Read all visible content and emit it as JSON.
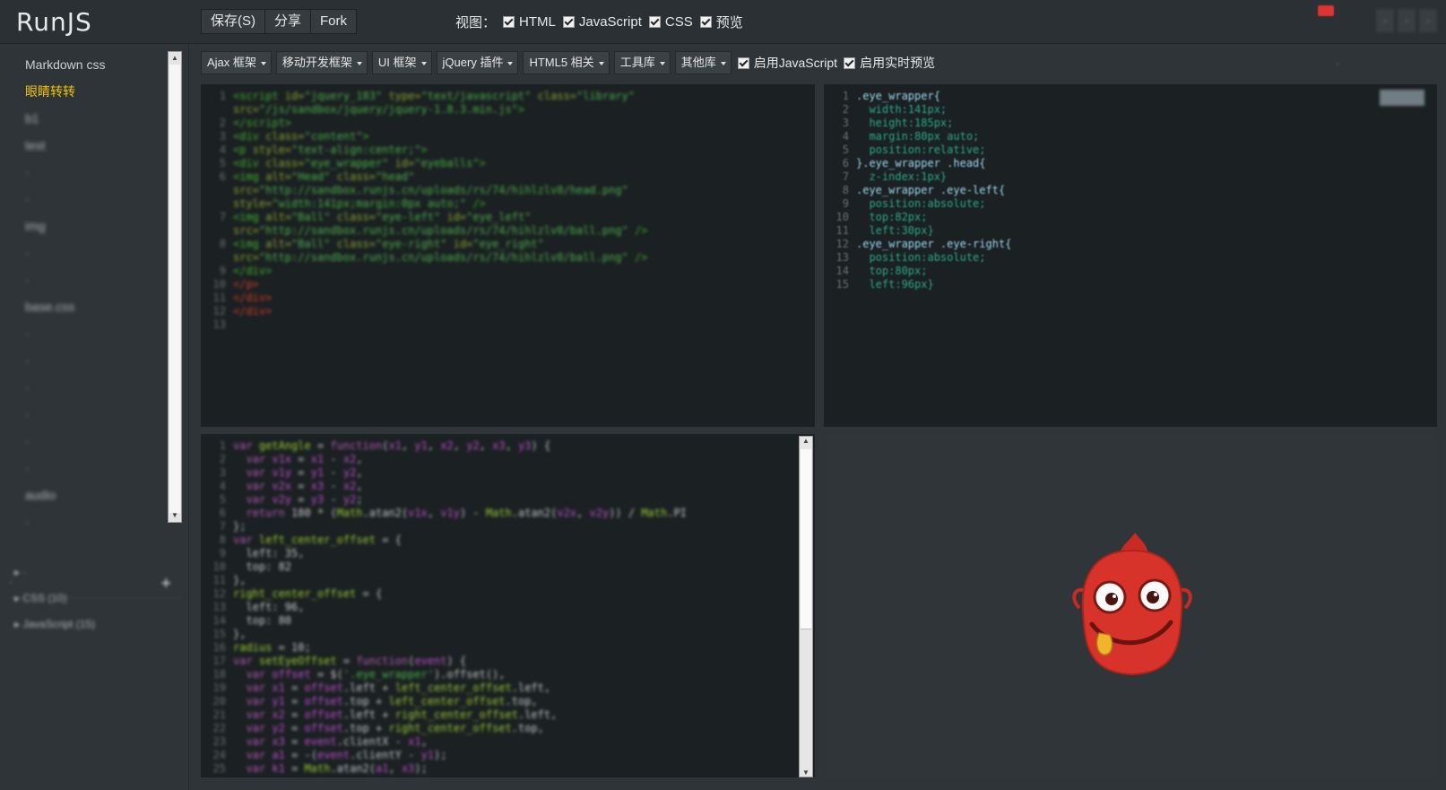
{
  "app": {
    "logo": "RunJS"
  },
  "header": {
    "buttons": [
      {
        "label": "保存(S)"
      },
      {
        "label": "分享"
      },
      {
        "label": "Fork"
      }
    ],
    "view_label": "视图：",
    "view_options": [
      {
        "label": "HTML",
        "checked": true
      },
      {
        "label": "JavaScript",
        "checked": true
      },
      {
        "label": "CSS",
        "checked": true
      },
      {
        "label": "预览",
        "checked": true
      }
    ],
    "right_buttons": [
      {
        "label": "·"
      },
      {
        "label": "·"
      },
      {
        "label": "·"
      }
    ]
  },
  "sidebar": {
    "files": [
      {
        "label": "Markdown css",
        "active": false,
        "readable": true
      },
      {
        "label": "眼睛转转",
        "active": true,
        "readable": true
      },
      {
        "label": "b1",
        "active": false,
        "readable": false
      },
      {
        "label": "test",
        "active": false,
        "readable": false
      },
      {
        "label": "·",
        "active": false,
        "readable": false
      },
      {
        "label": "·",
        "active": false,
        "readable": false
      },
      {
        "label": "img",
        "active": false,
        "readable": false
      },
      {
        "label": "·",
        "active": false,
        "readable": false
      },
      {
        "label": "·",
        "active": false,
        "readable": false
      },
      {
        "label": "base.css",
        "active": false,
        "readable": false
      },
      {
        "label": "·",
        "active": false,
        "readable": false
      },
      {
        "label": "·",
        "active": false,
        "readable": false
      },
      {
        "label": "·",
        "active": false,
        "readable": false
      },
      {
        "label": "·",
        "active": false,
        "readable": false
      },
      {
        "label": "·",
        "active": false,
        "readable": false
      },
      {
        "label": "·",
        "active": false,
        "readable": false
      },
      {
        "label": "audio",
        "active": false,
        "readable": false
      },
      {
        "label": "·",
        "active": false,
        "readable": false
      }
    ],
    "library_header": "·",
    "library_items": [
      {
        "label": "·"
      },
      {
        "label": "CSS (10)"
      },
      {
        "label": "JavaScript (15)"
      }
    ]
  },
  "toolbar": {
    "dropdowns": [
      {
        "label": "Ajax 框架"
      },
      {
        "label": "移动开发框架"
      },
      {
        "label": "UI 框架"
      },
      {
        "label": "jQuery 插件"
      },
      {
        "label": "HTML5 相关"
      },
      {
        "label": "工具库"
      },
      {
        "label": "其他库"
      }
    ],
    "toggles": [
      {
        "label": "启用JavaScript",
        "checked": true
      },
      {
        "label": "启用实时预览",
        "checked": true
      }
    ],
    "right_text": "·"
  },
  "editors": {
    "html_line_numbers": [
      "1",
      "",
      "2",
      "3",
      "4",
      "5",
      "6",
      "",
      "",
      "7",
      "",
      "8",
      "",
      "9",
      "10",
      "11",
      "12",
      "13"
    ],
    "css_lines": [
      ".eye_wrapper{",
      "  width:141px;",
      "  height:185px;",
      "  margin:80px auto;",
      "  position:relative;",
      "}.eye_wrapper .head{",
      "  z-index:1px}",
      ".eye_wrapper .eye-left{",
      "  position:absolute;",
      "  top:82px;",
      "  left:30px}",
      ".eye_wrapper .eye-right{",
      "  position:absolute;",
      "  top:80px;",
      "  left:96px}"
    ],
    "js_line_count": 25
  },
  "colors": {
    "accent_active_file": "#f2c400",
    "mascot_body": "#d8332a",
    "mascot_tongue": "#f2b42a"
  },
  "icons": [
    "plus-icon",
    "checkbox-icon",
    "dropdown-arrow-icon",
    "scroll-arrow-icon"
  ]
}
